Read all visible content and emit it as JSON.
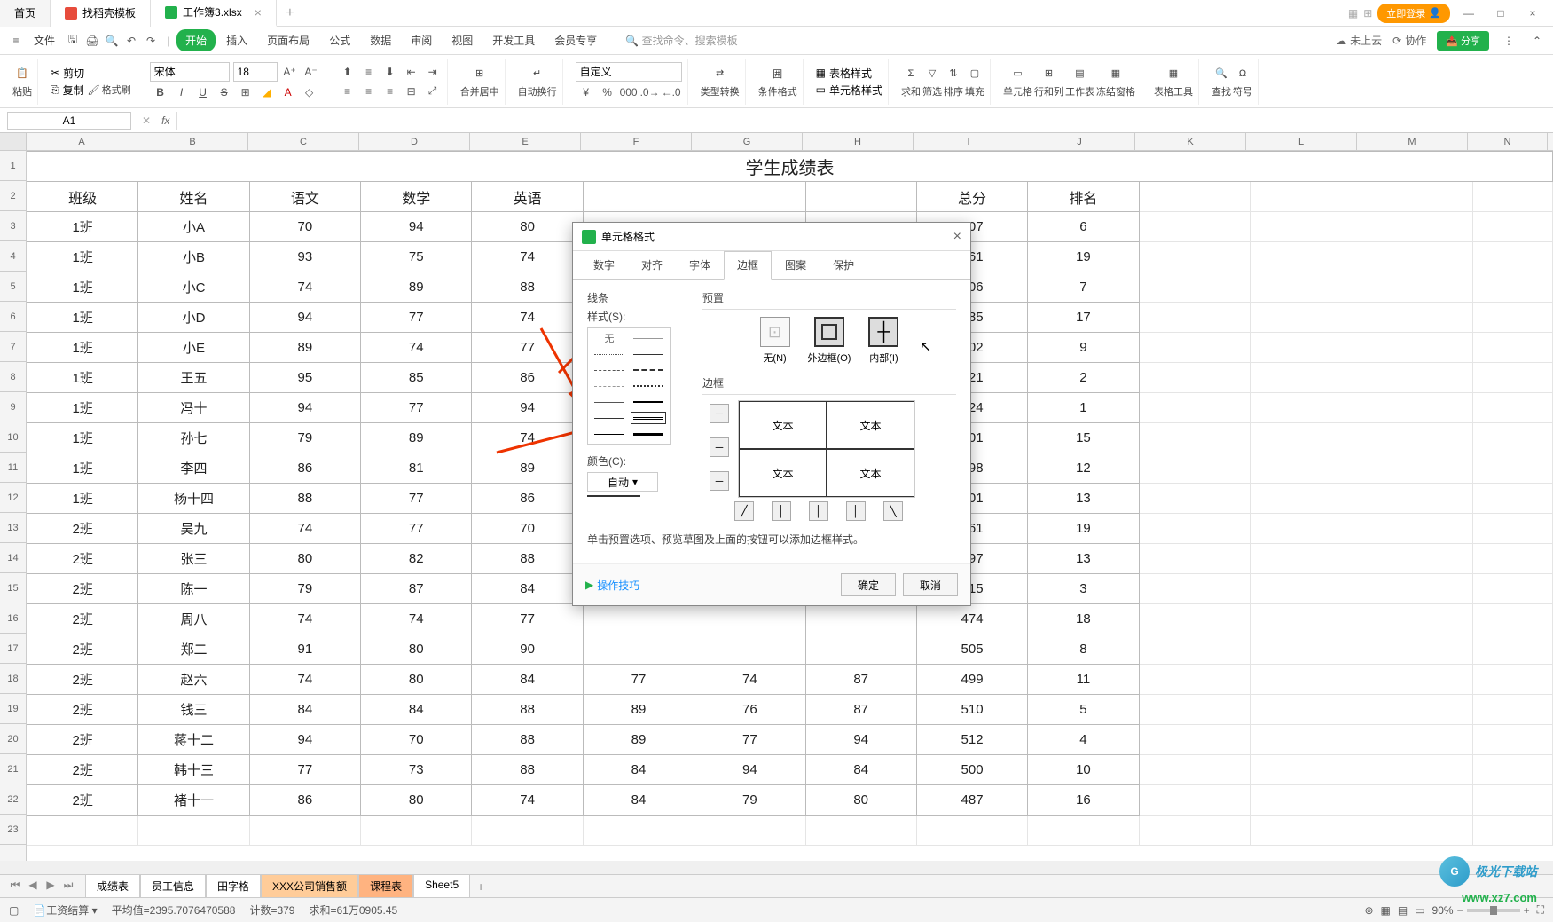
{
  "titlebar": {
    "tabs": [
      {
        "label": "首页",
        "type": "home"
      },
      {
        "label": "找稻壳模板",
        "type": "template"
      },
      {
        "label": "工作簿3.xlsx",
        "type": "active"
      }
    ],
    "login": "立即登录"
  },
  "menubar": {
    "file": "文件",
    "tabs": [
      "开始",
      "插入",
      "页面布局",
      "公式",
      "数据",
      "审阅",
      "视图",
      "开发工具",
      "会员专享"
    ],
    "active": "开始",
    "search_placeholder": "查找命令、搜索模板",
    "search_icon_label": "Q",
    "cloud": "未上云",
    "coop": "协作",
    "share": "分享"
  },
  "ribbon": {
    "paste": "粘贴",
    "cut": "剪切",
    "copy": "复制",
    "format_painter": "格式刷",
    "font_name": "宋体",
    "font_size": "18",
    "merge": "合并居中",
    "wrap": "自动换行",
    "number_format": "自定义",
    "type_convert": "类型转换",
    "cond_format": "条件格式",
    "table_style": "表格样式",
    "cell_style": "单元格样式",
    "sum": "求和",
    "filter": "筛选",
    "sort": "排序",
    "fill": "填充",
    "cell": "单元格",
    "rowcol": "行和列",
    "worksheet": "工作表",
    "freeze": "冻结窗格",
    "table_tools": "表格工具",
    "find": "查找",
    "symbol": "符号"
  },
  "formula": {
    "namebox": "A1",
    "fx": "fx"
  },
  "columns": [
    "A",
    "B",
    "C",
    "D",
    "E",
    "F",
    "G",
    "H",
    "I",
    "J",
    "K",
    "L",
    "M",
    "N"
  ],
  "sheet": {
    "title": "学生成绩表",
    "headers": [
      "班级",
      "姓名",
      "语文",
      "数学",
      "英语",
      "",
      "",
      "",
      "总分",
      "排名"
    ],
    "header_partial_right": {
      "col8": "总分",
      "col9": "排名"
    },
    "rows": [
      [
        "1班",
        "小A",
        "70",
        "94",
        "80",
        "",
        "",
        "",
        "507",
        "6"
      ],
      [
        "1班",
        "小B",
        "93",
        "75",
        "74",
        "",
        "",
        "",
        "461",
        "19"
      ],
      [
        "1班",
        "小C",
        "74",
        "89",
        "88",
        "",
        "",
        "",
        "506",
        "7"
      ],
      [
        "1班",
        "小D",
        "94",
        "77",
        "74",
        "",
        "",
        "",
        "485",
        "17"
      ],
      [
        "1班",
        "小E",
        "89",
        "74",
        "77",
        "",
        "",
        "",
        "502",
        "9"
      ],
      [
        "1班",
        "王五",
        "95",
        "85",
        "86",
        "",
        "",
        "",
        "521",
        "2"
      ],
      [
        "1班",
        "冯十",
        "94",
        "77",
        "94",
        "",
        "",
        "",
        "524",
        "1"
      ],
      [
        "1班",
        "孙七",
        "79",
        "89",
        "74",
        "",
        "",
        "",
        "501",
        "15"
      ],
      [
        "1班",
        "李四",
        "86",
        "81",
        "89",
        "",
        "",
        "",
        "498",
        "12"
      ],
      [
        "1班",
        "杨十四",
        "88",
        "77",
        "86",
        "",
        "",
        "",
        "501",
        "13"
      ],
      [
        "2班",
        "吴九",
        "74",
        "77",
        "70",
        "",
        "",
        "",
        "461",
        "19"
      ],
      [
        "2班",
        "张三",
        "80",
        "82",
        "88",
        "",
        "",
        "",
        "497",
        "13"
      ],
      [
        "2班",
        "陈一",
        "79",
        "87",
        "84",
        "",
        "",
        "",
        "515",
        "3"
      ],
      [
        "2班",
        "周八",
        "74",
        "74",
        "77",
        "",
        "",
        "",
        "474",
        "18"
      ],
      [
        "2班",
        "郑二",
        "91",
        "80",
        "90",
        "",
        "",
        "",
        "505",
        "8"
      ],
      [
        "2班",
        "赵六",
        "74",
        "80",
        "84",
        "77",
        "74",
        "87",
        "499",
        "11"
      ],
      [
        "2班",
        "钱三",
        "84",
        "84",
        "88",
        "89",
        "76",
        "87",
        "510",
        "5"
      ],
      [
        "2班",
        "蒋十二",
        "94",
        "70",
        "88",
        "89",
        "77",
        "94",
        "512",
        "4"
      ],
      [
        "2班",
        "韩十三",
        "77",
        "73",
        "88",
        "84",
        "94",
        "84",
        "500",
        "10"
      ],
      [
        "2班",
        "褚十一",
        "86",
        "80",
        "74",
        "84",
        "79",
        "80",
        "487",
        "16"
      ]
    ]
  },
  "dialog": {
    "title": "单元格格式",
    "tabs": [
      "数字",
      "对齐",
      "字体",
      "边框",
      "图案",
      "保护"
    ],
    "active_tab": "边框",
    "line_section": "线条",
    "style_label": "样式(S):",
    "none": "无",
    "color_label": "颜色(C):",
    "color_value": "自动",
    "preset_label": "预置",
    "preset_none": "无(N)",
    "preset_outer": "外边框(O)",
    "preset_inner": "内部(I)",
    "border_label": "边框",
    "sample_text": "文本",
    "hint": "单击预置选项、预览草图及上面的按钮可以添加边框样式。",
    "tip": "操作技巧",
    "ok": "确定",
    "cancel": "取消"
  },
  "sheet_tabs": {
    "tabs": [
      {
        "label": "成绩表",
        "cls": "active"
      },
      {
        "label": "员工信息",
        "cls": ""
      },
      {
        "label": "田字格",
        "cls": ""
      },
      {
        "label": "XXX公司销售额",
        "cls": "orange"
      },
      {
        "label": "课程表",
        "cls": "orange2"
      },
      {
        "label": "Sheet5",
        "cls": ""
      }
    ]
  },
  "statusbar": {
    "mode": "工资结算",
    "avg": "平均值=2395.7076470588",
    "count": "计数=379",
    "sum": "求和=61万0905.45",
    "zoom": "90%"
  },
  "watermark": {
    "text": "极光下载站",
    "url": "www.xz7.com"
  }
}
